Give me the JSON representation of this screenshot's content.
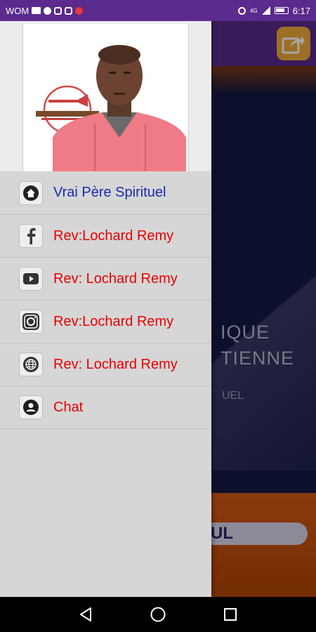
{
  "status_bar": {
    "carrier": "WOM",
    "time": "6:17",
    "network_label": "4G"
  },
  "background": {
    "title_line1": "IQUE",
    "title_line2": "TIENNE",
    "subtitle": "UEL",
    "pill_text": "UL",
    "colors": {
      "topbar": "#5a2a8c",
      "accent": "#f2a93b",
      "bottom": "#d45a12"
    }
  },
  "drawer": {
    "menu": [
      {
        "icon": "home-icon",
        "label": "Vrai Père Spirituel",
        "color": "#1a2bb0"
      },
      {
        "icon": "facebook-icon",
        "label": "Rev:Lochard Remy",
        "color": "#e60000"
      },
      {
        "icon": "youtube-icon",
        "label": "Rev: Lochard Remy",
        "color": "#e60000"
      },
      {
        "icon": "instagram-icon",
        "label": "Rev:Lochard Remy",
        "color": "#e60000"
      },
      {
        "icon": "globe-icon",
        "label": "Rev: Lochard Remy",
        "color": "#e60000"
      },
      {
        "icon": "chat-user-icon",
        "label": "Chat",
        "color": "#e60000"
      }
    ]
  },
  "navigation": {
    "back": "back-icon",
    "home": "home-circle-icon",
    "recents": "recents-icon"
  }
}
